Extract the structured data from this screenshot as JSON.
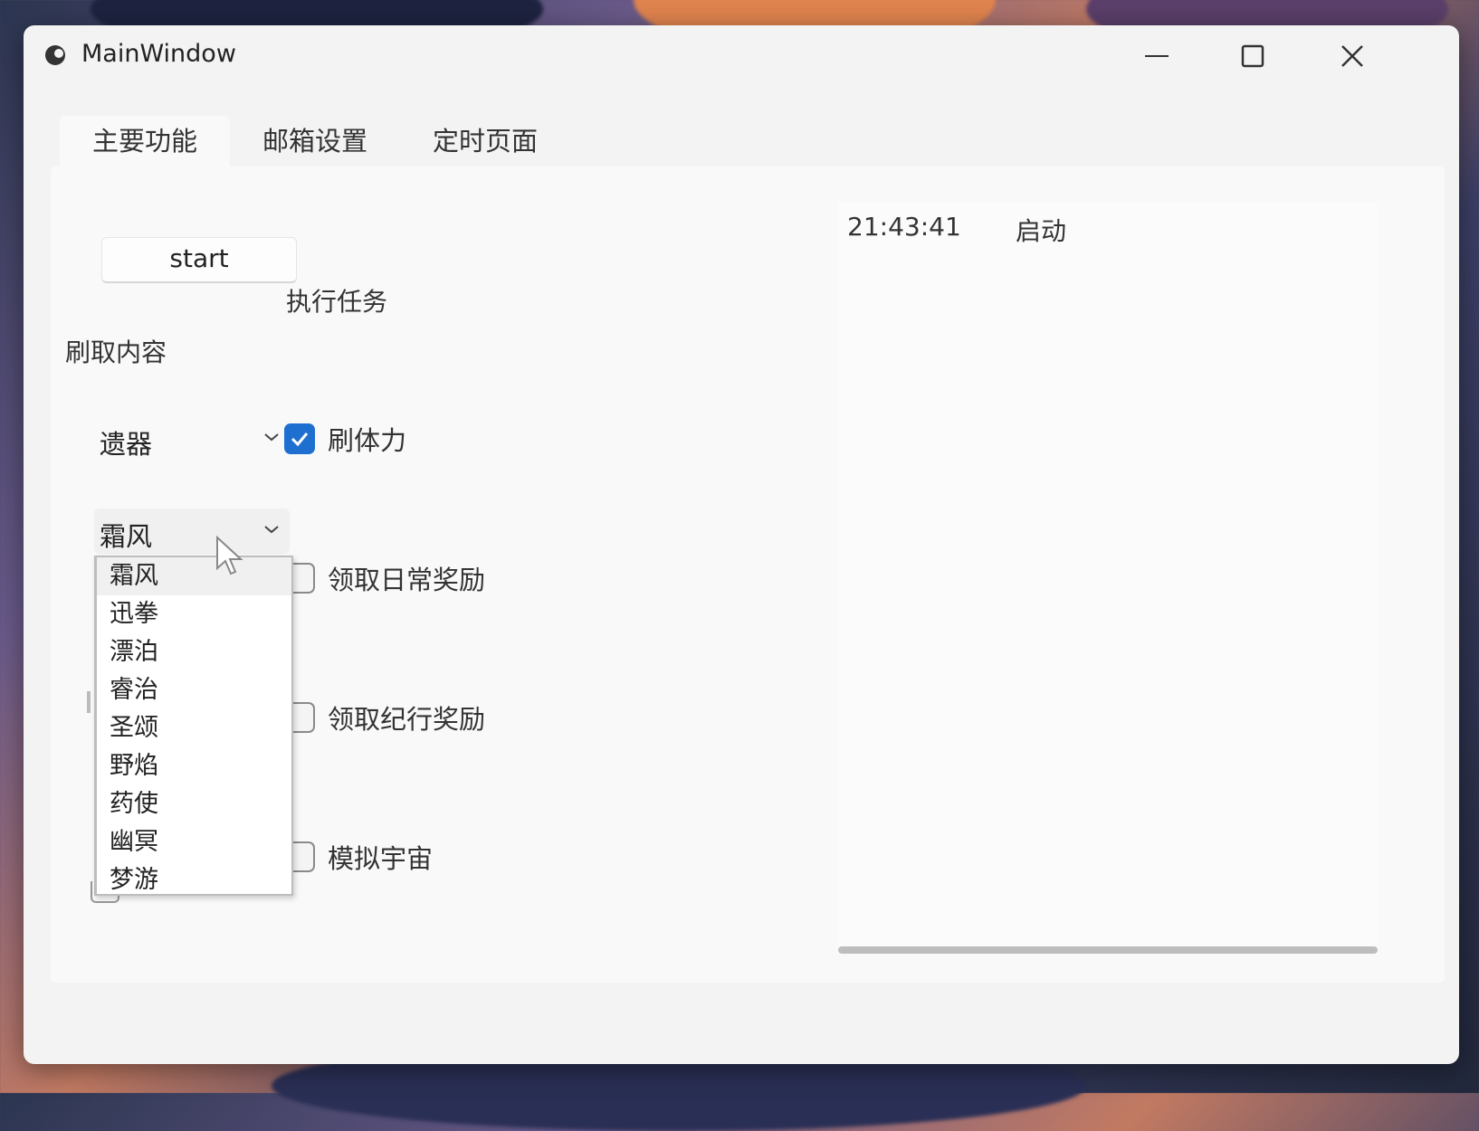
{
  "window": {
    "title": "MainWindow"
  },
  "tabs": [
    {
      "label": "主要功能",
      "active": true
    },
    {
      "label": "邮箱设置",
      "active": false
    },
    {
      "label": "定时页面",
      "active": false
    }
  ],
  "main": {
    "start_button": "start",
    "task_label": "执行任务",
    "content_label": "刷取内容",
    "combo_type": {
      "selected": "遗器"
    },
    "combo_target": {
      "selected": "霜风"
    },
    "dropdown_options": [
      "霜风",
      "迅拳",
      "漂泊",
      "睿治",
      "圣颂",
      "野焰",
      "药使",
      "幽冥",
      "梦游"
    ],
    "hovered_option": "霜风",
    "checkboxes": [
      {
        "label": "刷体力",
        "checked": true
      },
      {
        "label": "领取日常奖励",
        "checked": false
      },
      {
        "label": "领取纪行奖励",
        "checked": false
      },
      {
        "label": "模拟宇宙",
        "checked": false
      }
    ]
  },
  "log": {
    "entries": [
      {
        "time": "21:43:41",
        "message": "启动"
      }
    ]
  },
  "colors": {
    "accent": "#1f6fd1",
    "window_bg": "#f3f3f3",
    "panel_bg": "#f9f9f9"
  }
}
